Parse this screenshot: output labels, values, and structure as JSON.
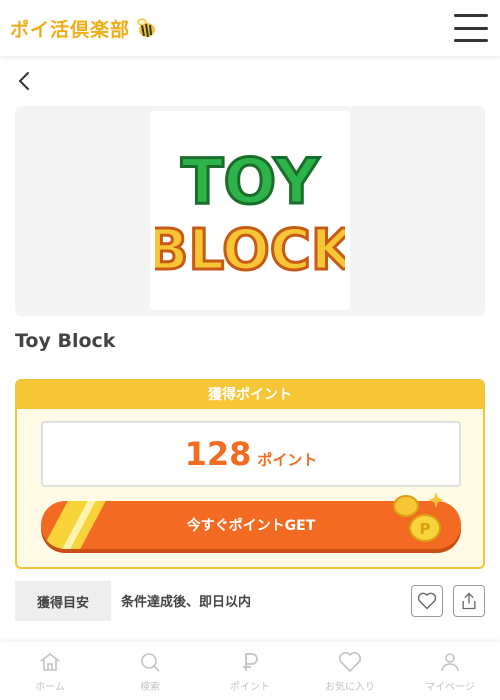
{
  "header": {
    "logo_text": "ポイ活倶楽部",
    "menu_icon": "hamburger-menu-icon"
  },
  "hero": {
    "logo_line1": "TOY",
    "logo_line2": "BLOCK"
  },
  "app": {
    "title": "Toy Block"
  },
  "points": {
    "heading": "獲得ポイント",
    "value": "128",
    "unit": "ポイント",
    "cta": "今すぐポイントGET"
  },
  "estimate": {
    "label": "獲得目安",
    "text": "条件達成後、即日以内"
  },
  "nav": {
    "items": [
      {
        "label": "ホーム",
        "icon": "home-icon"
      },
      {
        "label": "検索",
        "icon": "search-icon"
      },
      {
        "label": "ポイント",
        "icon": "point-icon"
      },
      {
        "label": "お気に入り",
        "icon": "heart-icon"
      },
      {
        "label": "マイページ",
        "icon": "person-icon"
      }
    ]
  },
  "colors": {
    "brand": "#f0ad16",
    "accent": "#f36b23",
    "highlight": "#f6c636"
  }
}
